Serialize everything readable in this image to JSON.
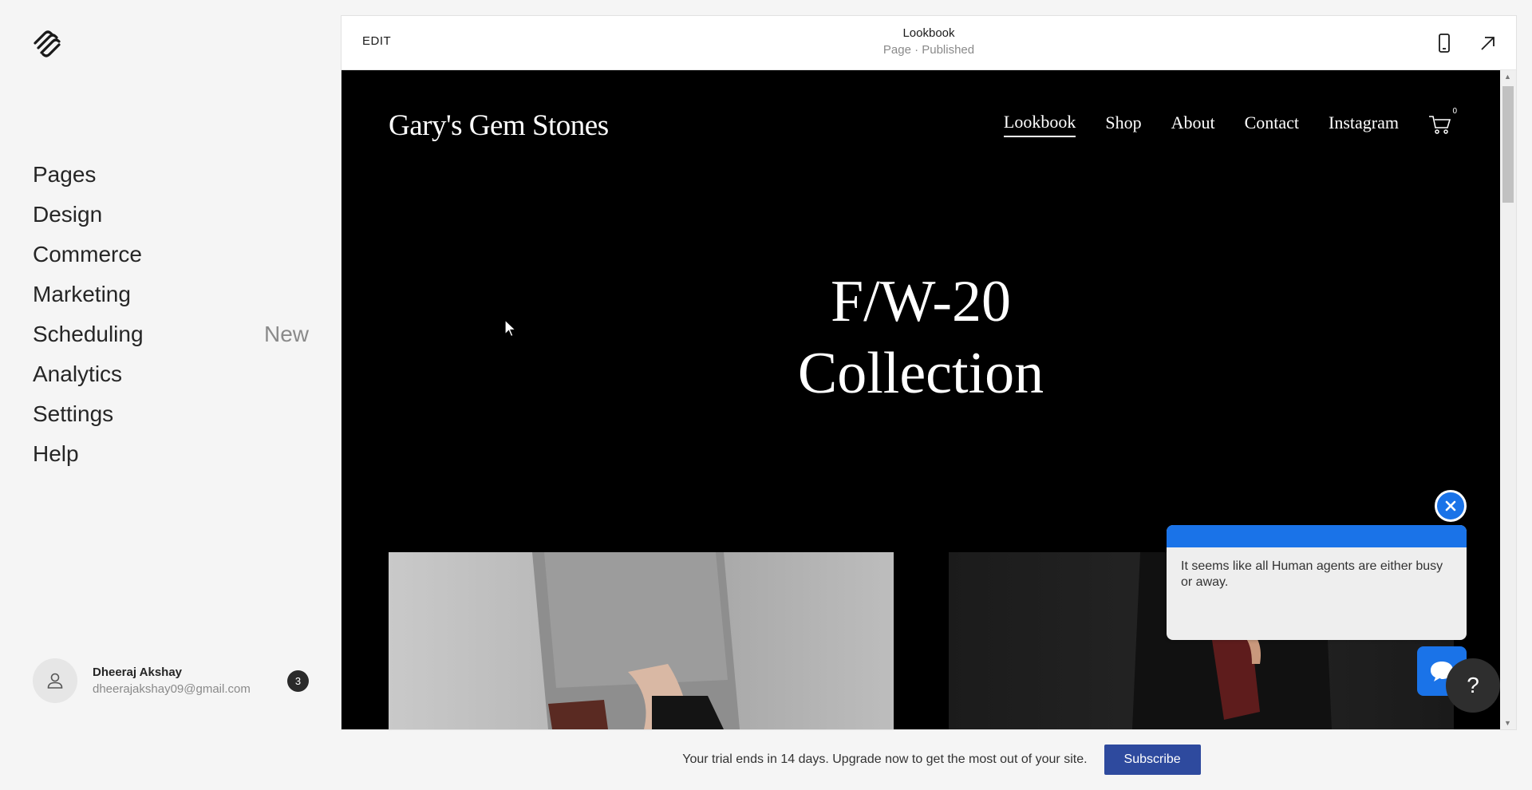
{
  "sidebar": {
    "items": [
      {
        "label": "Pages"
      },
      {
        "label": "Design"
      },
      {
        "label": "Commerce"
      },
      {
        "label": "Marketing"
      },
      {
        "label": "Scheduling",
        "badge": "New"
      },
      {
        "label": "Analytics"
      },
      {
        "label": "Settings"
      },
      {
        "label": "Help"
      }
    ],
    "user": {
      "name": "Dheeraj Akshay",
      "email": "dheerajakshay09@gmail.com",
      "notifications": "3"
    }
  },
  "editor": {
    "edit_label": "EDIT",
    "page_title": "Lookbook",
    "page_status": "Page · Published"
  },
  "site": {
    "title": "Gary's Gem Stones",
    "nav": [
      "Lookbook",
      "Shop",
      "About",
      "Contact",
      "Instagram"
    ],
    "active_nav": "Lookbook",
    "cart_count": "0",
    "hero_line1": "F/W-20",
    "hero_line2": "Collection"
  },
  "chat": {
    "message": "It seems like all Human agents are either busy or away.",
    "help_label": "?"
  },
  "trial": {
    "text": "Your trial ends in 14 days. Upgrade now to get the most out of your site.",
    "button": "Subscribe"
  },
  "colors": {
    "accent": "#1a73e8",
    "subscribe": "#2e4a9e",
    "site_bg": "#000000"
  }
}
